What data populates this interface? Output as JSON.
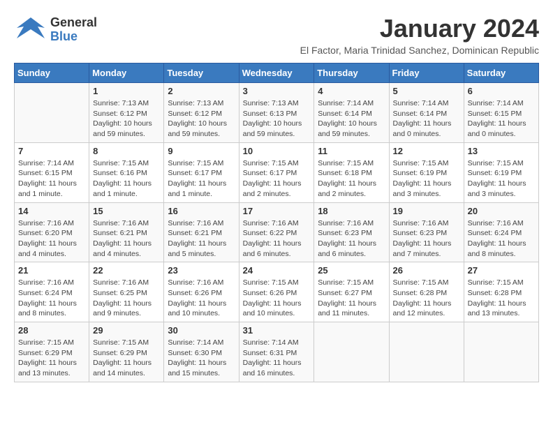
{
  "header": {
    "logo": {
      "general": "General",
      "blue": "Blue"
    },
    "title": "January 2024",
    "subtitle": "El Factor, Maria Trinidad Sanchez, Dominican Republic"
  },
  "calendar": {
    "days_of_week": [
      "Sunday",
      "Monday",
      "Tuesday",
      "Wednesday",
      "Thursday",
      "Friday",
      "Saturday"
    ],
    "weeks": [
      [
        {
          "day": "",
          "sunrise": "",
          "sunset": "",
          "daylight": ""
        },
        {
          "day": "1",
          "sunrise": "Sunrise: 7:13 AM",
          "sunset": "Sunset: 6:12 PM",
          "daylight": "Daylight: 10 hours and 59 minutes."
        },
        {
          "day": "2",
          "sunrise": "Sunrise: 7:13 AM",
          "sunset": "Sunset: 6:12 PM",
          "daylight": "Daylight: 10 hours and 59 minutes."
        },
        {
          "day": "3",
          "sunrise": "Sunrise: 7:13 AM",
          "sunset": "Sunset: 6:13 PM",
          "daylight": "Daylight: 10 hours and 59 minutes."
        },
        {
          "day": "4",
          "sunrise": "Sunrise: 7:14 AM",
          "sunset": "Sunset: 6:14 PM",
          "daylight": "Daylight: 10 hours and 59 minutes."
        },
        {
          "day": "5",
          "sunrise": "Sunrise: 7:14 AM",
          "sunset": "Sunset: 6:14 PM",
          "daylight": "Daylight: 11 hours and 0 minutes."
        },
        {
          "day": "6",
          "sunrise": "Sunrise: 7:14 AM",
          "sunset": "Sunset: 6:15 PM",
          "daylight": "Daylight: 11 hours and 0 minutes."
        }
      ],
      [
        {
          "day": "7",
          "sunrise": "Sunrise: 7:14 AM",
          "sunset": "Sunset: 6:15 PM",
          "daylight": "Daylight: 11 hours and 1 minute."
        },
        {
          "day": "8",
          "sunrise": "Sunrise: 7:15 AM",
          "sunset": "Sunset: 6:16 PM",
          "daylight": "Daylight: 11 hours and 1 minute."
        },
        {
          "day": "9",
          "sunrise": "Sunrise: 7:15 AM",
          "sunset": "Sunset: 6:17 PM",
          "daylight": "Daylight: 11 hours and 1 minute."
        },
        {
          "day": "10",
          "sunrise": "Sunrise: 7:15 AM",
          "sunset": "Sunset: 6:17 PM",
          "daylight": "Daylight: 11 hours and 2 minutes."
        },
        {
          "day": "11",
          "sunrise": "Sunrise: 7:15 AM",
          "sunset": "Sunset: 6:18 PM",
          "daylight": "Daylight: 11 hours and 2 minutes."
        },
        {
          "day": "12",
          "sunrise": "Sunrise: 7:15 AM",
          "sunset": "Sunset: 6:19 PM",
          "daylight": "Daylight: 11 hours and 3 minutes."
        },
        {
          "day": "13",
          "sunrise": "Sunrise: 7:15 AM",
          "sunset": "Sunset: 6:19 PM",
          "daylight": "Daylight: 11 hours and 3 minutes."
        }
      ],
      [
        {
          "day": "14",
          "sunrise": "Sunrise: 7:16 AM",
          "sunset": "Sunset: 6:20 PM",
          "daylight": "Daylight: 11 hours and 4 minutes."
        },
        {
          "day": "15",
          "sunrise": "Sunrise: 7:16 AM",
          "sunset": "Sunset: 6:21 PM",
          "daylight": "Daylight: 11 hours and 4 minutes."
        },
        {
          "day": "16",
          "sunrise": "Sunrise: 7:16 AM",
          "sunset": "Sunset: 6:21 PM",
          "daylight": "Daylight: 11 hours and 5 minutes."
        },
        {
          "day": "17",
          "sunrise": "Sunrise: 7:16 AM",
          "sunset": "Sunset: 6:22 PM",
          "daylight": "Daylight: 11 hours and 6 minutes."
        },
        {
          "day": "18",
          "sunrise": "Sunrise: 7:16 AM",
          "sunset": "Sunset: 6:23 PM",
          "daylight": "Daylight: 11 hours and 6 minutes."
        },
        {
          "day": "19",
          "sunrise": "Sunrise: 7:16 AM",
          "sunset": "Sunset: 6:23 PM",
          "daylight": "Daylight: 11 hours and 7 minutes."
        },
        {
          "day": "20",
          "sunrise": "Sunrise: 7:16 AM",
          "sunset": "Sunset: 6:24 PM",
          "daylight": "Daylight: 11 hours and 8 minutes."
        }
      ],
      [
        {
          "day": "21",
          "sunrise": "Sunrise: 7:16 AM",
          "sunset": "Sunset: 6:24 PM",
          "daylight": "Daylight: 11 hours and 8 minutes."
        },
        {
          "day": "22",
          "sunrise": "Sunrise: 7:16 AM",
          "sunset": "Sunset: 6:25 PM",
          "daylight": "Daylight: 11 hours and 9 minutes."
        },
        {
          "day": "23",
          "sunrise": "Sunrise: 7:16 AM",
          "sunset": "Sunset: 6:26 PM",
          "daylight": "Daylight: 11 hours and 10 minutes."
        },
        {
          "day": "24",
          "sunrise": "Sunrise: 7:15 AM",
          "sunset": "Sunset: 6:26 PM",
          "daylight": "Daylight: 11 hours and 10 minutes."
        },
        {
          "day": "25",
          "sunrise": "Sunrise: 7:15 AM",
          "sunset": "Sunset: 6:27 PM",
          "daylight": "Daylight: 11 hours and 11 minutes."
        },
        {
          "day": "26",
          "sunrise": "Sunrise: 7:15 AM",
          "sunset": "Sunset: 6:28 PM",
          "daylight": "Daylight: 11 hours and 12 minutes."
        },
        {
          "day": "27",
          "sunrise": "Sunrise: 7:15 AM",
          "sunset": "Sunset: 6:28 PM",
          "daylight": "Daylight: 11 hours and 13 minutes."
        }
      ],
      [
        {
          "day": "28",
          "sunrise": "Sunrise: 7:15 AM",
          "sunset": "Sunset: 6:29 PM",
          "daylight": "Daylight: 11 hours and 13 minutes."
        },
        {
          "day": "29",
          "sunrise": "Sunrise: 7:15 AM",
          "sunset": "Sunset: 6:29 PM",
          "daylight": "Daylight: 11 hours and 14 minutes."
        },
        {
          "day": "30",
          "sunrise": "Sunrise: 7:14 AM",
          "sunset": "Sunset: 6:30 PM",
          "daylight": "Daylight: 11 hours and 15 minutes."
        },
        {
          "day": "31",
          "sunrise": "Sunrise: 7:14 AM",
          "sunset": "Sunset: 6:31 PM",
          "daylight": "Daylight: 11 hours and 16 minutes."
        },
        {
          "day": "",
          "sunrise": "",
          "sunset": "",
          "daylight": ""
        },
        {
          "day": "",
          "sunrise": "",
          "sunset": "",
          "daylight": ""
        },
        {
          "day": "",
          "sunrise": "",
          "sunset": "",
          "daylight": ""
        }
      ]
    ]
  }
}
